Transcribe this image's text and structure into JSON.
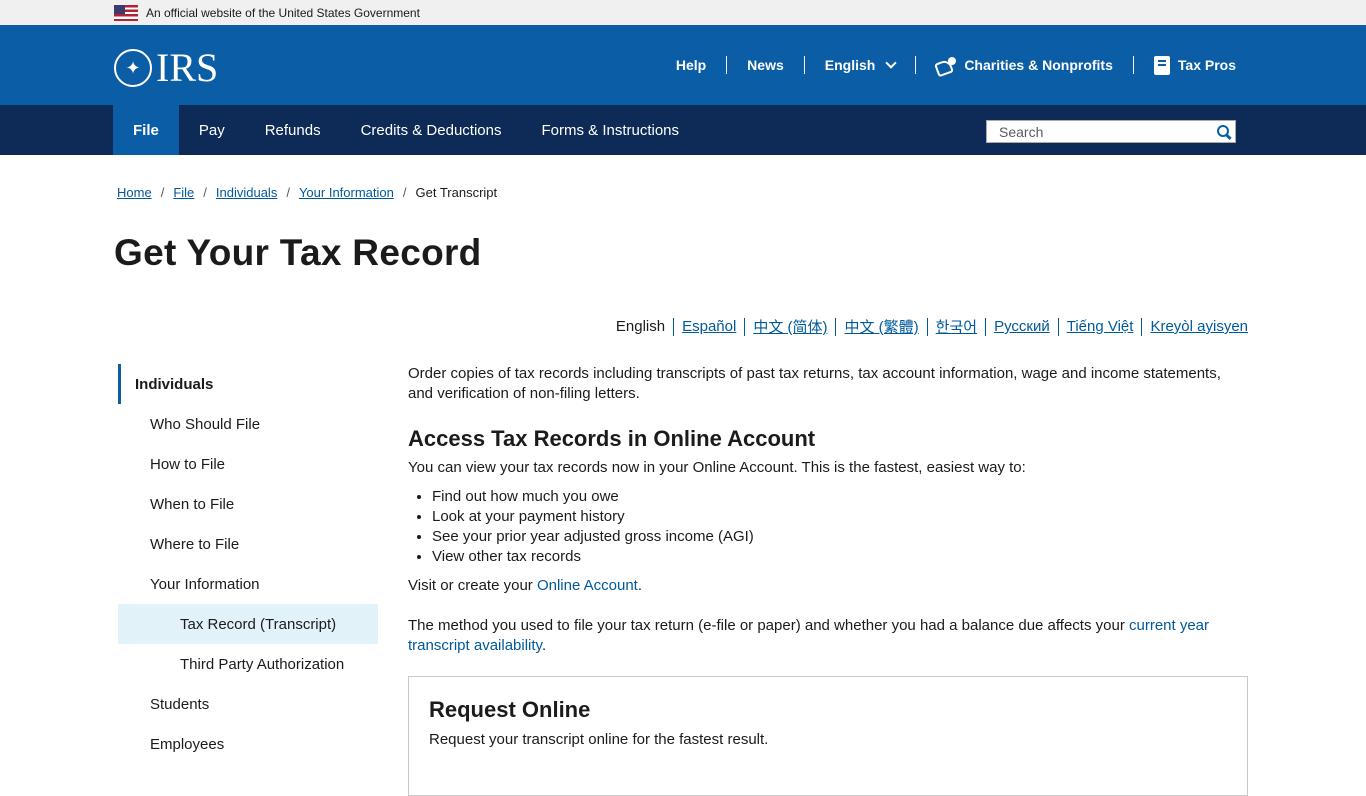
{
  "gov_banner": {
    "text": "An official website of the United States Government"
  },
  "header": {
    "logo_text": "IRS",
    "utility": {
      "help": "Help",
      "news": "News",
      "language": "English",
      "charities": "Charities & Nonprofits",
      "tax_pros": "Tax Pros"
    },
    "nav": [
      "File",
      "Pay",
      "Refunds",
      "Credits & Deductions",
      "Forms & Instructions"
    ],
    "active_nav": "File",
    "search_placeholder": "Search"
  },
  "breadcrumb": {
    "items": [
      "Home",
      "File",
      "Individuals",
      "Your Information"
    ],
    "current": "Get Transcript"
  },
  "page_title": "Get Your Tax Record",
  "languages": {
    "current": "English",
    "links": [
      "Español",
      "中文 (简体)",
      "中文 (繁體)",
      "한국어",
      "Русский",
      "Tiếng Việt",
      "Kreyòl ayisyen"
    ]
  },
  "sidebar": {
    "items": [
      {
        "label": "Individuals",
        "level": 0
      },
      {
        "label": "Who Should File",
        "level": 1
      },
      {
        "label": "How to File",
        "level": 1
      },
      {
        "label": "When to File",
        "level": 1
      },
      {
        "label": "Where to File",
        "level": 1
      },
      {
        "label": "Your Information",
        "level": 1
      },
      {
        "label": "Tax Record (Transcript)",
        "level": 2,
        "selected": true
      },
      {
        "label": "Third Party Authorization",
        "level": 2
      },
      {
        "label": "Students",
        "level": 1
      },
      {
        "label": "Employees",
        "level": 1
      }
    ]
  },
  "content": {
    "intro": "Order copies of tax records including transcripts of past tax returns, tax account information, wage and income statements, and verification of non-filing letters.",
    "section_title": "Access Tax Records in Online Account",
    "lead": "You can view your tax records now in your Online Account. This is the fastest, easiest way to:",
    "bullets": [
      "Find out how much you owe",
      "Look at your payment history",
      "See your prior year adjusted gross income (AGI)",
      "View other tax records"
    ],
    "visit_prefix": "Visit or create your ",
    "visit_link": "Online Account",
    "visit_suffix": ".",
    "method_prefix": "The method you used to file your tax return (e-file or paper) and whether you had a balance due affects  your ",
    "method_link": "current year transcript availability",
    "method_suffix": ".",
    "card_title": "Request Online",
    "card_text": "Request your transcript online for the fastest result."
  },
  "colors": {
    "header_blue": "#0b5da5",
    "nav_navy": "#0d2b56",
    "link_blue": "#00599c",
    "selected_bg": "#e1f3f8"
  }
}
